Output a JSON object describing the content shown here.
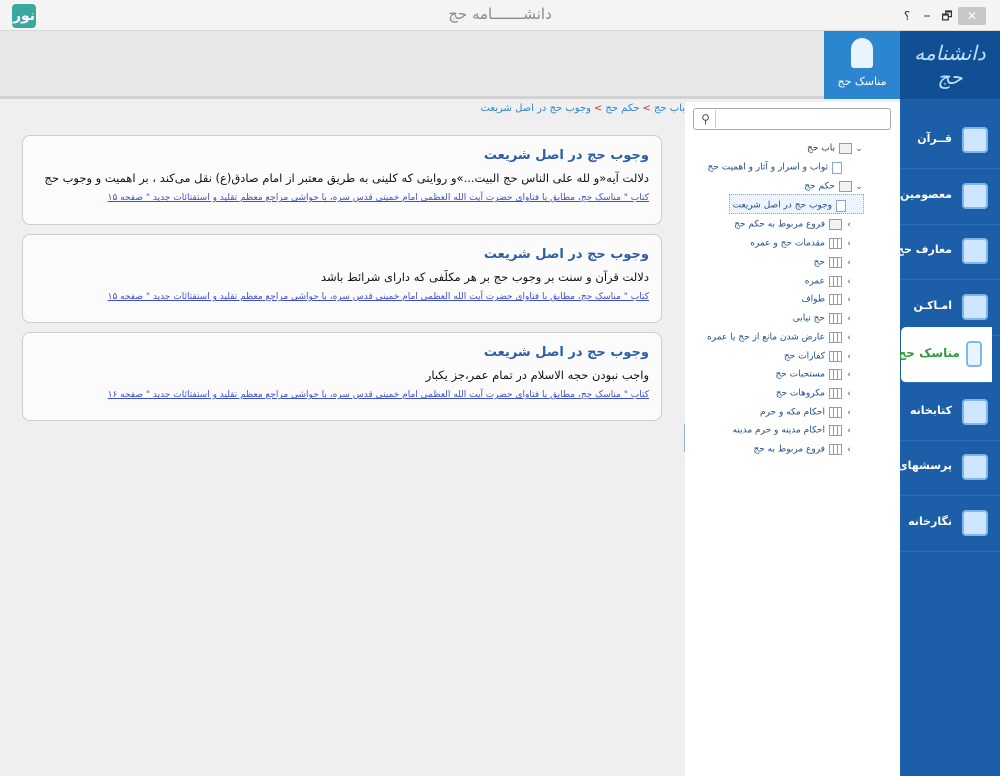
{
  "window": {
    "title": "دانشـــــــامه حج",
    "help": "؟",
    "minimize": "–",
    "restore": "🗗",
    "close": "✕",
    "logo": "نور"
  },
  "brand": {
    "text": "دانشنامه حج"
  },
  "nav": {
    "items": [
      {
        "label": "قــرآن",
        "icon": "quran-icon"
      },
      {
        "label": "معصومین",
        "icon": "shrine-icon"
      },
      {
        "label": "معارف حج",
        "icon": "kaaba-icon"
      },
      {
        "label": "امـاکـن",
        "icon": "places-icon"
      },
      {
        "label": "مناسک حج",
        "icon": "pilgrim-icon",
        "active": true
      },
      {
        "label": "کتابخانه",
        "icon": "library-icon"
      },
      {
        "label": "پرسشهای رایـج",
        "icon": "faq-icon"
      },
      {
        "label": "نگارخانه",
        "icon": "gallery-icon"
      }
    ]
  },
  "topbar": {
    "tab_label": "مناسک حج"
  },
  "breadcrumb": {
    "items": [
      "باب حج",
      "حکم حج",
      "وجوب حج در اصل شریعت"
    ],
    "separator": ">"
  },
  "tree": {
    "search_placeholder": "",
    "rows": [
      {
        "label": "باب حج",
        "twisty": "⌄",
        "icon": "folder"
      },
      {
        "label": "ثواب و اسرار و آثار و اهمیت حج",
        "twisty": "",
        "icon": "doc"
      },
      {
        "label": "حکم حج",
        "twisty": "⌄",
        "icon": "folder"
      },
      {
        "label": "وجوب حج در اصل شریعت",
        "twisty": "",
        "icon": "doc"
      },
      {
        "label": "فروع مربوط به حکم حج",
        "twisty": "›",
        "icon": "folder"
      },
      {
        "label": "مقدمات حج و عمره",
        "twisty": "›",
        "icon": "book"
      },
      {
        "label": "حج",
        "twisty": "›",
        "icon": "book"
      },
      {
        "label": "عمره",
        "twisty": "›",
        "icon": "book"
      },
      {
        "label": "طواف",
        "twisty": "›",
        "icon": "book"
      },
      {
        "label": "حج نیابی",
        "twisty": "›",
        "icon": "book"
      },
      {
        "label": "عارض شدن مانع از حج یا عمره",
        "twisty": "›",
        "icon": "book"
      },
      {
        "label": "کفارات حج",
        "twisty": "›",
        "icon": "book"
      },
      {
        "label": "مستحبات حج",
        "twisty": "›",
        "icon": "book"
      },
      {
        "label": "مکروهات حج",
        "twisty": "›",
        "icon": "book"
      },
      {
        "label": "احکام مکه و حرم",
        "twisty": "›",
        "icon": "book"
      },
      {
        "label": "احکام مدینه و حرم مدینه",
        "twisty": "›",
        "icon": "book"
      },
      {
        "label": "فروع مربوط به حج",
        "twisty": "›",
        "icon": "book"
      }
    ]
  },
  "cards": [
    {
      "title": "وجوب حج در اصل شریعت",
      "body": "دلالت آیه«و لله علی الناس حج البیت...»و روایتی که کلینی به طریق معتبر از امام صادق(ع) نقل می‌کند ، بر اهمیت و وجوب حج",
      "source": "کتاب \" مناسک حج، مطابق با فتاوای حضرت آیت الله العظمی امام خمینی قدس سره، با حواشی مراجع معظم تقلید و استفتائات جدید \" صفحه ۱۵"
    },
    {
      "title": "وجوب حج در اصل شریعت",
      "body": "دلالت قرآن و سنت بر وجوب حج بر هر مکلّفی که دارای شرائط باشد",
      "source": "کتاب \" مناسک حج، مطابق با فتاوای حضرت آیت الله العظمی امام خمینی قدس سره، با حواشی مراجع معظم تقلید و استفتائات جدید \" صفحه ۱۵"
    },
    {
      "title": "وجوب حج در اصل شریعت",
      "body": "واجب نبودن حجه الاسلام در تمام عمر،جز یکبار",
      "source": "کتاب \" مناسک حج، مطابق با فتاوای حضرت آیت الله العظمی امام خمینی قدس سره، با حواشی مراجع معظم تقلید و استفتائات جدید \" صفحه ۱۶"
    }
  ]
}
